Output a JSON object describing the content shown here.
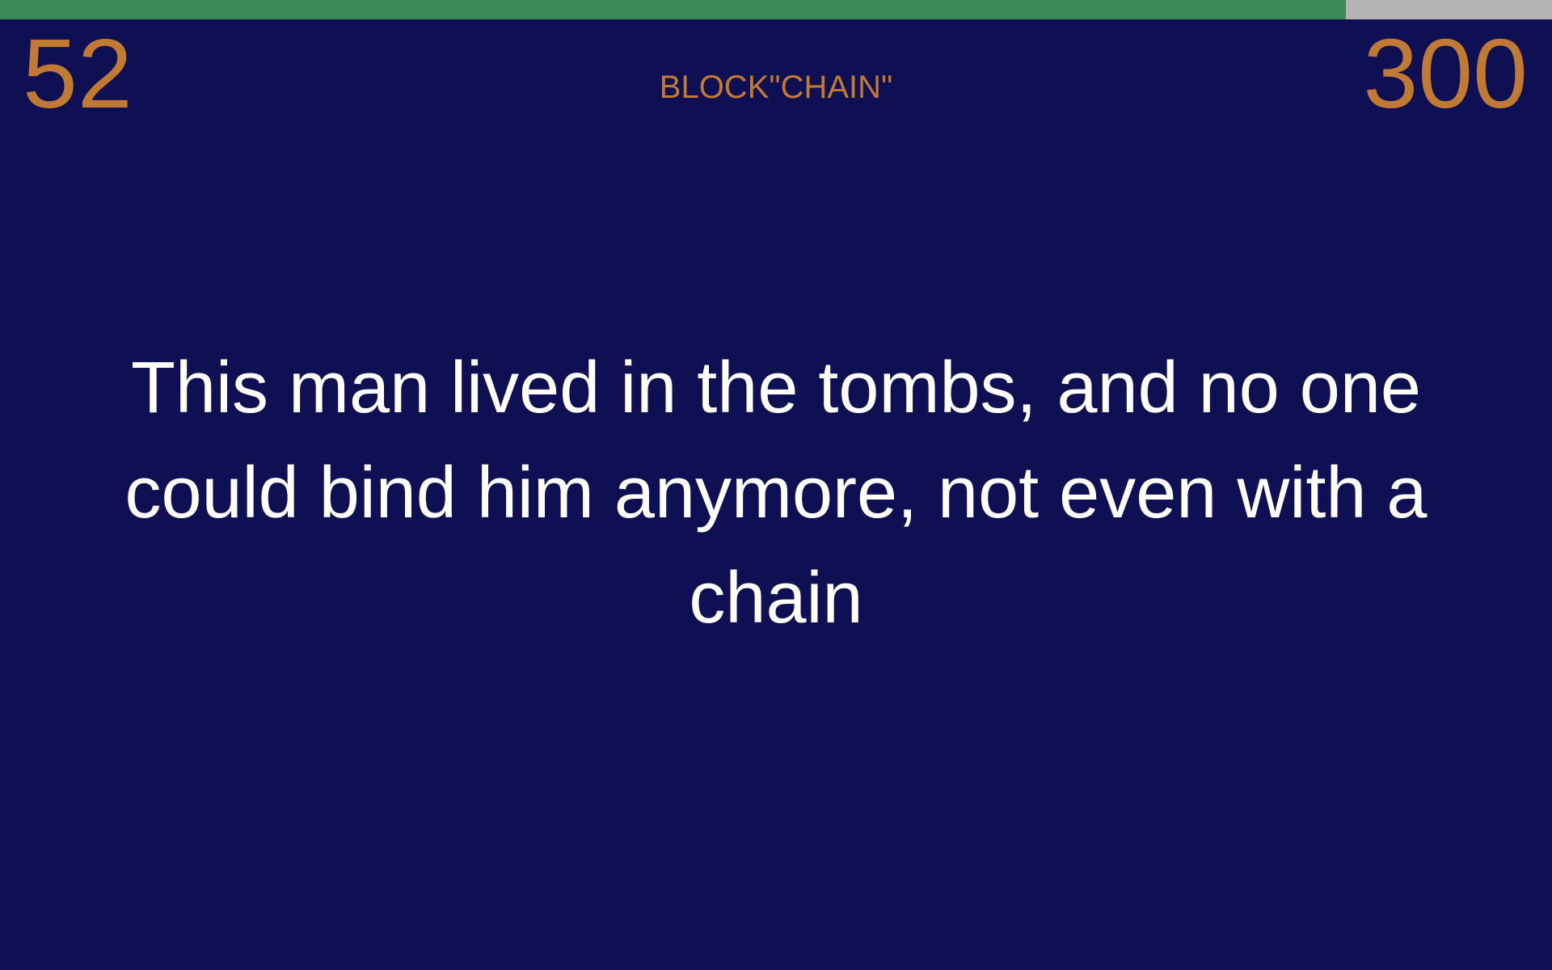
{
  "timer": {
    "fraction_remaining": 0.867,
    "fill_color": "#3e8a57",
    "track_color": "#b3b3b3"
  },
  "seconds_left": "52",
  "points": "300",
  "category": "BLOCK\"CHAIN\"",
  "clue": "This man lived in the tombs, and no one could bind him anymore, not even with a chain",
  "colors": {
    "background": "#0f1053",
    "accent": "#c07a33",
    "clue_text": "#ffffff"
  }
}
